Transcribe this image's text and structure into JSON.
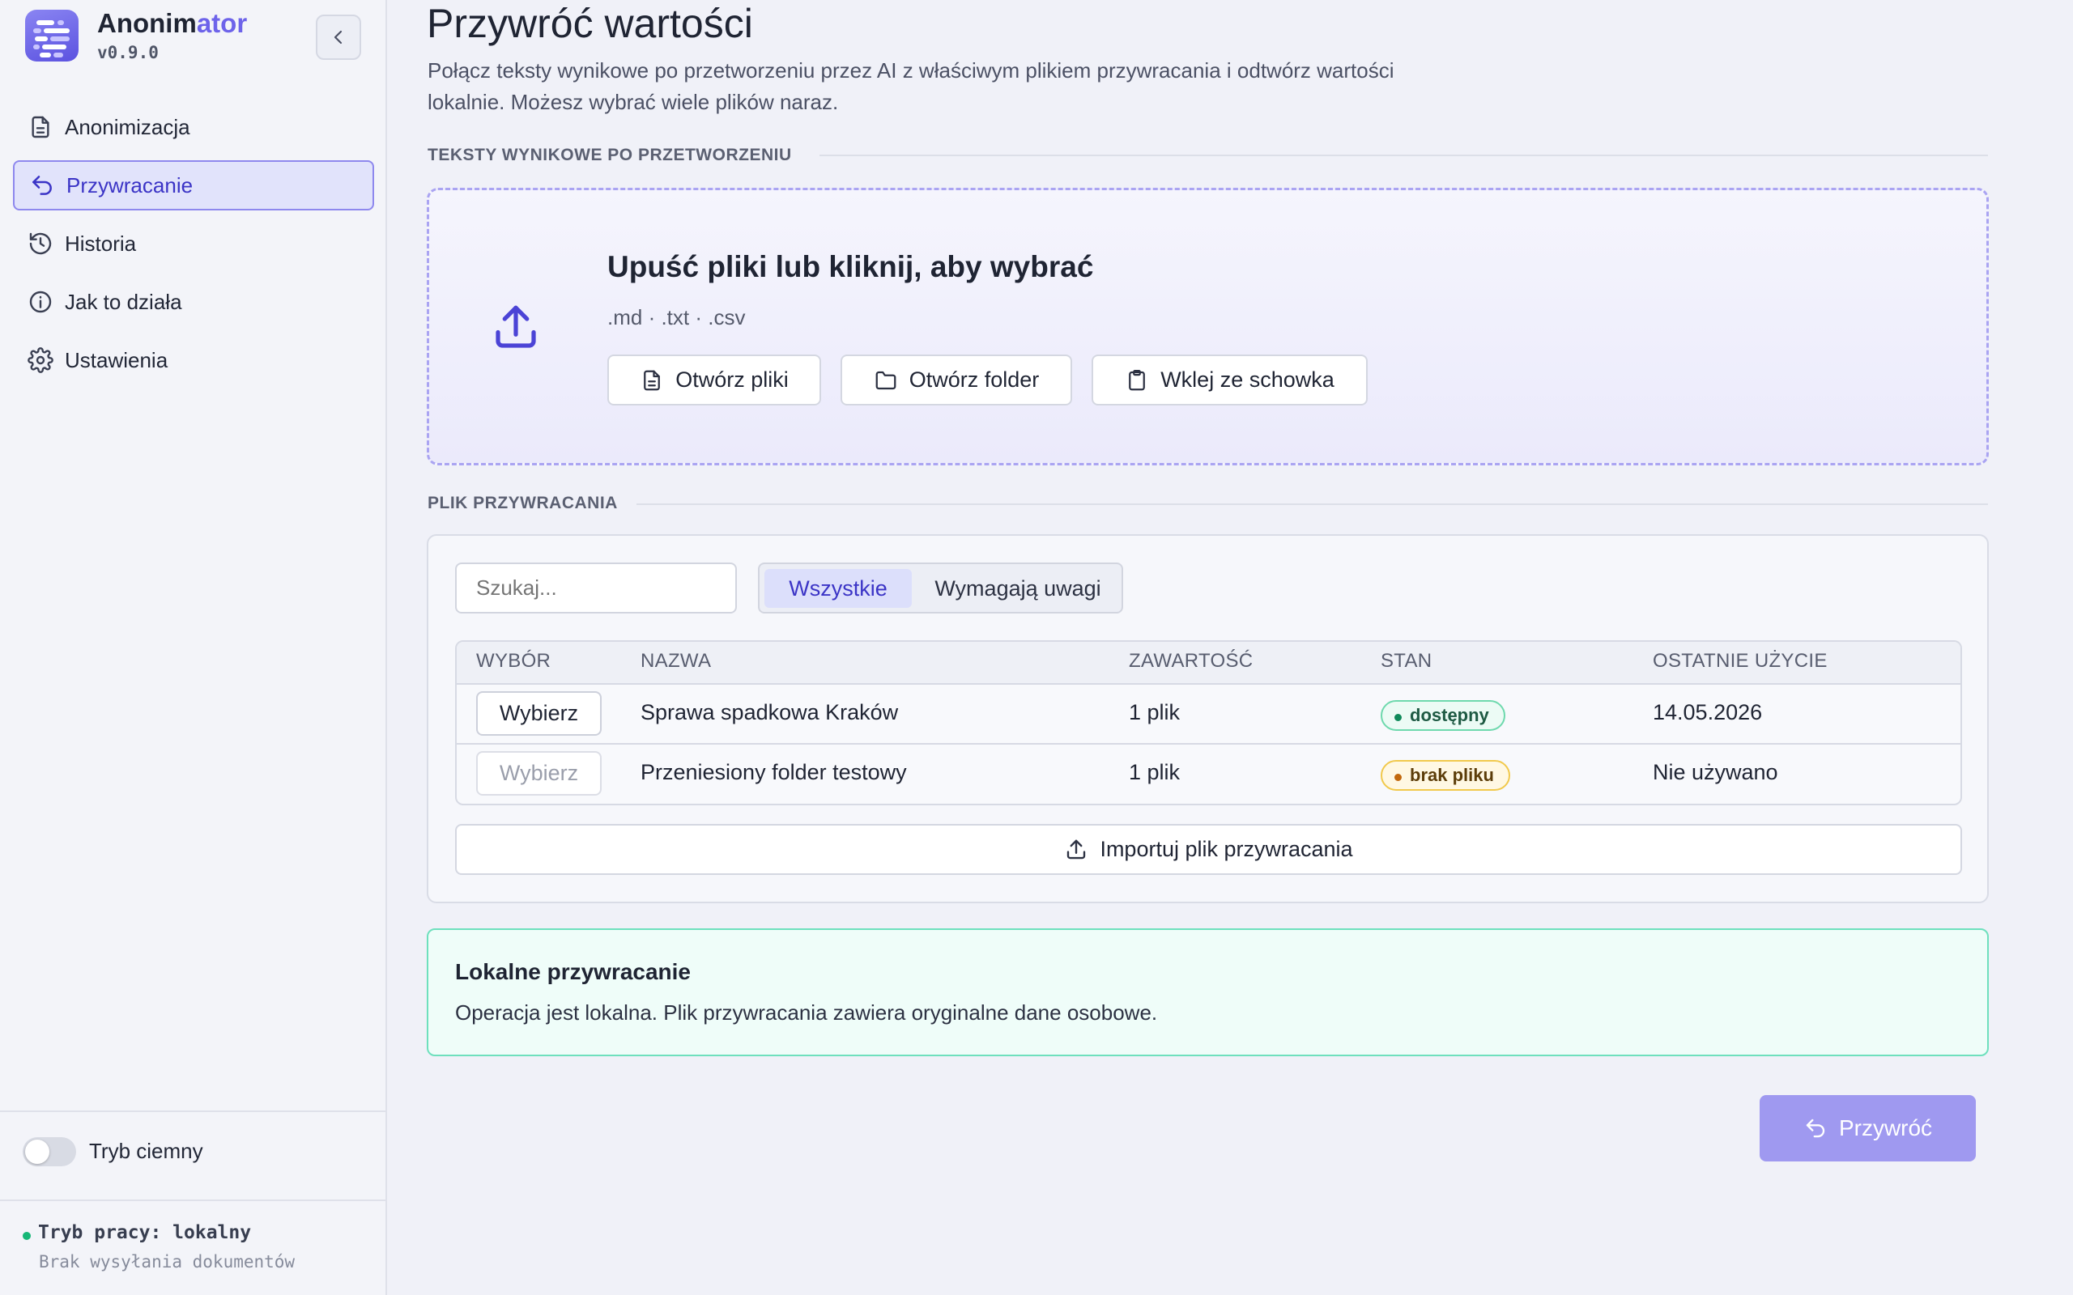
{
  "app": {
    "name_main": "Anonim",
    "name_accent": "ator",
    "version": "v0.9.0",
    "accent_color": "#6d63ea"
  },
  "sidebar": {
    "items": [
      {
        "label": "Anonimizacja",
        "icon": "document-icon",
        "active": false
      },
      {
        "label": "Przywracanie",
        "icon": "undo-icon",
        "active": true
      },
      {
        "label": "Historia",
        "icon": "history-icon",
        "active": false
      },
      {
        "label": "Jak to działa",
        "icon": "info-icon",
        "active": false
      },
      {
        "label": "Ustawienia",
        "icon": "gear-icon",
        "active": false
      }
    ],
    "dark_mode_label": "Tryb ciemny",
    "dark_mode_on": false,
    "status_title": "Tryb pracy: lokalny",
    "status_subtitle": "Brak wysyłania dokumentów"
  },
  "main": {
    "title": "Przywróć wartości",
    "description": "Połącz teksty wynikowe po przetworzeniu przez AI z właściwym plikiem przywracania i odtwórz wartości lokalnie. Możesz wybrać wiele plików naraz.",
    "section_output_label": "TEKSTY WYNIKOWE PO PRZETWORZENIU",
    "dropzone": {
      "title": "Upuść pliki lub kliknij, aby wybrać",
      "types": ".md · .txt · .csv",
      "open_files": "Otwórz pliki",
      "open_folder": "Otwórz folder",
      "paste": "Wklej ze schowka"
    },
    "section_restore_label": "PLIK PRZYWRACANIA",
    "search_placeholder": "Szukaj...",
    "filters": {
      "all": "Wszystkie",
      "attention": "Wymagają uwagi",
      "active": "all"
    },
    "table": {
      "headers": [
        "WYBÓR",
        "NAZWA",
        "ZAWARTOŚĆ",
        "STAN",
        "OSTATNIE UŻYCIE"
      ],
      "rows": [
        {
          "select": "Wybierz",
          "name": "Sprawa spadkowa Kraków",
          "content": "1 plik",
          "status": "dostępny",
          "status_type": "ok",
          "last_used": "14.05.2026",
          "enabled": true
        },
        {
          "select": "Wybierz",
          "name": "Przeniesiony folder testowy",
          "content": "1 plik",
          "status": "brak pliku",
          "status_type": "warn",
          "last_used": "Nie używano",
          "enabled": false
        }
      ]
    },
    "import_label": "Importuj plik przywracania",
    "notice": {
      "title": "Lokalne przywracanie",
      "text": "Operacja jest lokalna. Plik przywracania zawiera oryginalne dane osobowe."
    },
    "restore_button": "Przywróć"
  }
}
